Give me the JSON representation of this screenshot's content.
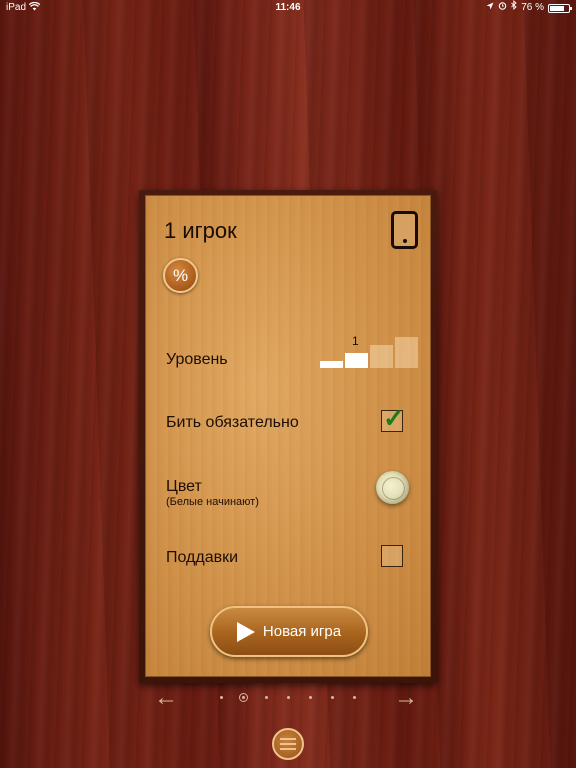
{
  "statusbar": {
    "device": "iPad",
    "time": "11:46",
    "battery": "76 %",
    "battery_level": 0.76
  },
  "panel": {
    "title": "1 игрок",
    "percent_label": "%",
    "level_label": "Уровень",
    "level_number": "1",
    "level_value": 2,
    "level_max": 4,
    "mandatory_capture_label": "Бить обязательно",
    "mandatory_capture_checked": true,
    "color_label": "Цвет",
    "color_sublabel": "(Белые начинают)",
    "giveaway_label": "Поддавки",
    "giveaway_checked": false,
    "new_game_label": "Новая игра"
  },
  "pager": {
    "total": 7,
    "current": 2
  },
  "icons": {
    "wifi": "wifi-icon",
    "device": "tablet-icon",
    "play": "play-icon",
    "menu": "menu-icon"
  }
}
